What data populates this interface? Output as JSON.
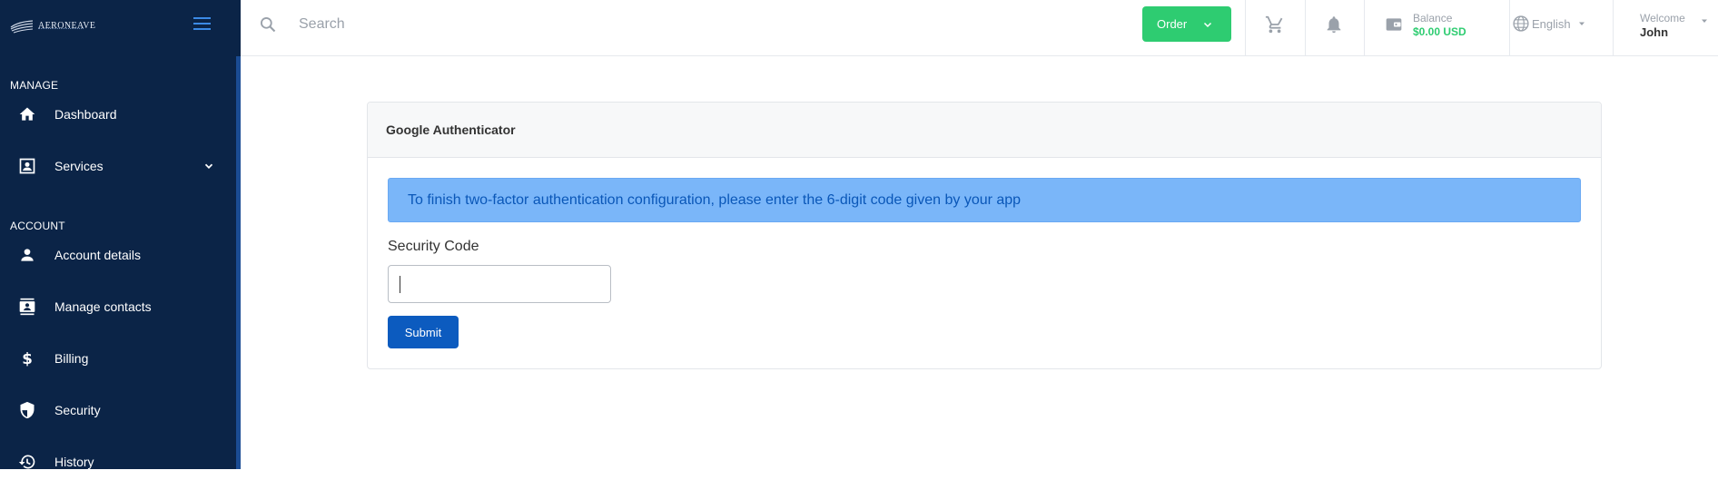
{
  "brand": {
    "name": "AERONEAVE",
    "logo_icon": "wing-logo-icon"
  },
  "sidebar": {
    "sections": [
      {
        "label": "MANAGE"
      },
      {
        "label": "ACCOUNT"
      }
    ],
    "items": [
      {
        "label": "Dashboard",
        "icon": "home-icon"
      },
      {
        "label": "Services",
        "icon": "services-icon"
      },
      {
        "label": "Account details",
        "icon": "person-icon"
      },
      {
        "label": "Manage contacts",
        "icon": "contacts-icon"
      },
      {
        "label": "Billing",
        "icon": "dollar-icon"
      },
      {
        "label": "Security",
        "icon": "shield-icon"
      },
      {
        "label": "History",
        "icon": "history-icon"
      }
    ]
  },
  "topbar": {
    "search_placeholder": "Search",
    "order_label": "Order",
    "balance_caption": "Balance",
    "balance_value": "$0.00 USD",
    "language": "English",
    "welcome_caption": "Welcome",
    "user_name": "John"
  },
  "card": {
    "title": "Google Authenticator",
    "alert_text": "To finish two-factor authentication configuration, please enter the 6-digit code given by your app",
    "field_label": "Security Code",
    "code_value": "",
    "submit_label": "Submit"
  },
  "colors": {
    "sidebar_bg": "#0b2447",
    "accent_green": "#2ecc71",
    "primary_blue": "#0c5bbf",
    "alert_bg": "#7ab6f9"
  }
}
